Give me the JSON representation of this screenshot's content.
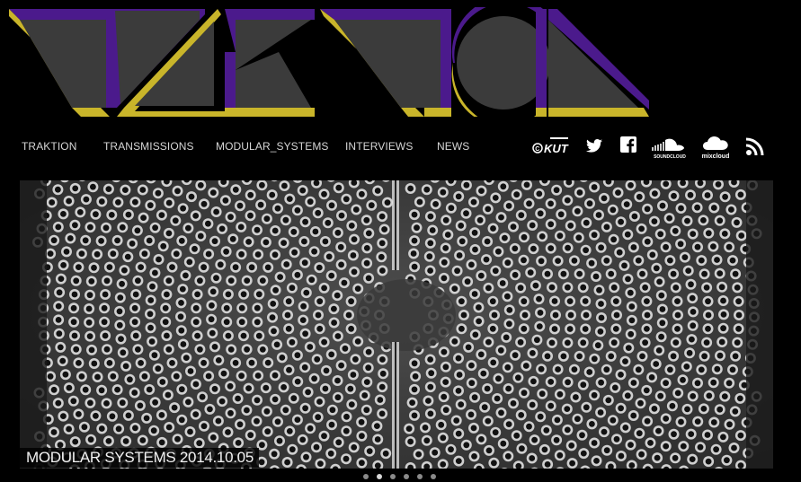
{
  "site": {
    "logo_alt": "TRAKTION",
    "colors": {
      "purple": "#4b1a8c",
      "yellow": "#c9b52a",
      "grey": "#3b3b3b",
      "background": "#000000"
    }
  },
  "nav": {
    "items": [
      {
        "label": "TRAKTION"
      },
      {
        "label": "TRANSMISSIONS"
      },
      {
        "label": "MODULAR_SYSTEMS"
      },
      {
        "label": "INTERVIEWS"
      },
      {
        "label": "NEWS"
      }
    ]
  },
  "social": {
    "kut": {
      "icon": "kut-radio-icon",
      "label": "©KUT"
    },
    "twitter": {
      "icon": "twitter-icon"
    },
    "facebook": {
      "icon": "facebook-icon"
    },
    "soundcloud": {
      "icon": "soundcloud-icon",
      "caption": "SOUNDCLOUD"
    },
    "mixcloud": {
      "icon": "mixcloud-icon",
      "caption": "mixcloud"
    },
    "rss": {
      "icon": "rss-icon"
    }
  },
  "slider": {
    "caption": "MODULAR SYSTEMS 2014.10.05",
    "slide_count": 6,
    "active_index": 1
  }
}
